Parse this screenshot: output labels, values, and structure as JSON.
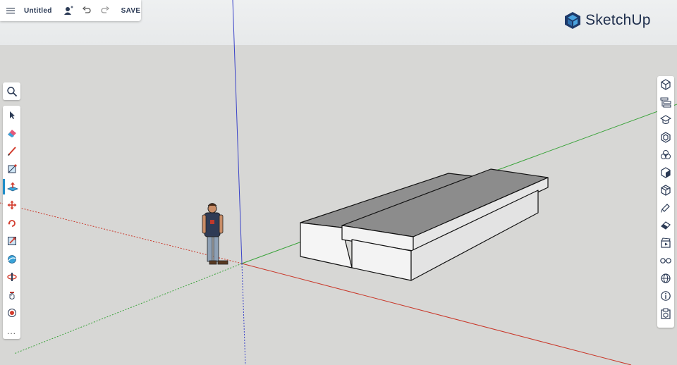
{
  "app": {
    "brand": "SketchUp",
    "brand_color": "#1f2f4d"
  },
  "topbar": {
    "menu_icon": "hamburger-icon",
    "document_title": "Untitled",
    "share_icon": "add-user-icon",
    "undo_icon": "undo-icon",
    "redo_icon": "redo-icon",
    "save_label": "SAVE"
  },
  "left_toolbar": {
    "search_icon": "search-icon",
    "tools": [
      "select-tool-icon",
      "eraser-tool-icon",
      "pencil-line-tool-icon",
      "rectangle-tool-icon",
      "push-pull-tool-icon",
      "move-tool-icon",
      "rotate-tool-icon",
      "scale-tool-icon",
      "orbit-tool-icon",
      "section-plane-tool-icon",
      "pan-tool-icon",
      "walk-tool-icon"
    ],
    "active_tool": "push-pull-tool-icon",
    "more_label": "..."
  },
  "right_panel": {
    "icons": [
      "entity-info-icon",
      "outliner-icon",
      "instructor-icon",
      "components-icon",
      "materials-icon",
      "styles-icon",
      "3d-warehouse-icon",
      "tags-icon",
      "soften-edges-icon",
      "scenes-icon",
      "display-icon",
      "geo-location-icon",
      "info-icon",
      "solid-inspector-icon"
    ]
  },
  "axes_colors": {
    "red": "#d23b2c",
    "green": "#3fa63f",
    "blue": "#3a43c8"
  }
}
